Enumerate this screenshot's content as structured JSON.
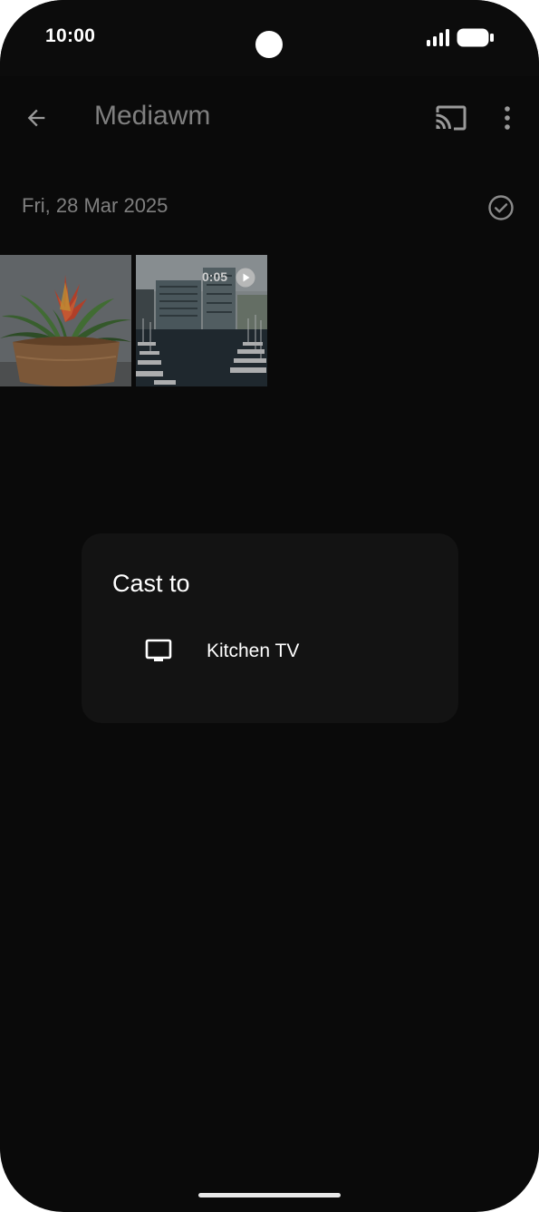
{
  "status_bar": {
    "time": "10:00",
    "icons": [
      "signal-icon",
      "battery-icon"
    ]
  },
  "app_bar": {
    "title": "Mediawm",
    "icons": [
      "back-arrow-icon",
      "cast-icon",
      "more-vert-icon"
    ]
  },
  "gallery": {
    "date_header": "Fri, 28 Mar 2025",
    "select_icon": "check-circle-icon",
    "items": [
      {
        "kind": "photo",
        "subject": "potted-plant"
      },
      {
        "kind": "video",
        "subject": "marina",
        "duration": "0:05"
      }
    ]
  },
  "cast_dialog": {
    "title": "Cast to",
    "devices": [
      {
        "label": "Kitchen TV",
        "icon": "tv-icon"
      }
    ]
  },
  "colors": {
    "background": "#0a0a0a",
    "dialog": "#131313",
    "dimmed_text": "#7f7f7f",
    "text": "#ffffff"
  }
}
